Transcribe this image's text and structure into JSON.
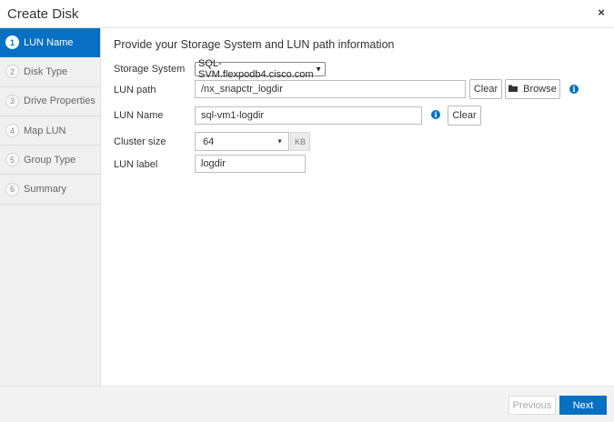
{
  "window": {
    "title": "Create Disk",
    "close_glyph": "×"
  },
  "sidebar": {
    "steps": [
      {
        "number": "1",
        "label": "LUN Name",
        "active": true
      },
      {
        "number": "2",
        "label": "Disk Type",
        "active": false
      },
      {
        "number": "3",
        "label": "Drive Properties",
        "active": false
      },
      {
        "number": "4",
        "label": "Map LUN",
        "active": false
      },
      {
        "number": "5",
        "label": "Group Type",
        "active": false
      },
      {
        "number": "6",
        "label": "Summary",
        "active": false
      }
    ]
  },
  "form": {
    "heading": "Provide your Storage System and LUN path information",
    "storage_system": {
      "label": "Storage System",
      "value": "SQL-SVM.flexpodb4.cisco.com"
    },
    "lun_path": {
      "label": "LUN path",
      "value": "/nx_snapctr_logdir",
      "clear_label": "Clear",
      "browse_label": "Browse"
    },
    "lun_name": {
      "label": "LUN Name",
      "value": "sql-vm1-logdir",
      "clear_label": "Clear"
    },
    "cluster_size": {
      "label": "Cluster size",
      "value": "64",
      "unit": "KB"
    },
    "lun_label": {
      "label": "LUN label",
      "value": "logdir"
    }
  },
  "footer": {
    "previous_label": "Previous",
    "next_label": "Next"
  },
  "colors": {
    "accent": "#0770c4",
    "sidebar_bg": "#f0f0f0",
    "footer_bg": "#f3f3f3"
  }
}
